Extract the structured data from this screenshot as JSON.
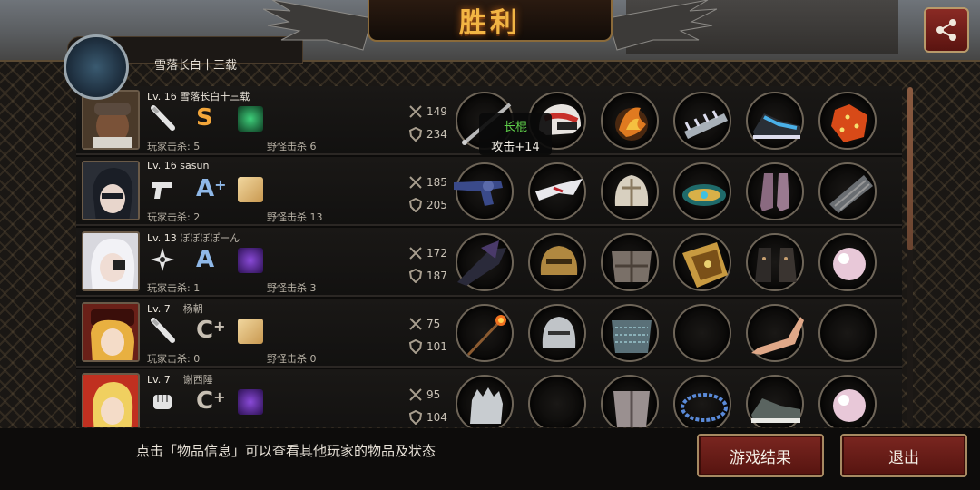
{
  "header": {
    "title": "胜利",
    "share_icon": "share-icon"
  },
  "behind_panel": {
    "player_name": "雪落长白十三载"
  },
  "tooltip": {
    "item_name": "长棍",
    "item_stat": "攻击+14"
  },
  "players": [
    {
      "level_label": "Lv. 16",
      "name": "雪落长白十三载",
      "weapon_icon": "bat-icon",
      "grade": "S",
      "grade_plus": "",
      "player_kills": "玩家击杀: 5",
      "monster_kills": "野怪击杀 6",
      "atk": "149",
      "def": "234",
      "equipment": [
        "staff",
        "racing-helmet",
        "fire-charm",
        "spiked-bracer",
        "blue-sneakers",
        "red-dice"
      ]
    },
    {
      "level_label": "Lv. 16",
      "name": "sasun",
      "weapon_icon": "pistol-icon",
      "grade": "A",
      "grade_plus": "+",
      "player_kills": "玩家击杀: 2",
      "monster_kills": "野怪击杀 13",
      "atk": "185",
      "def": "205",
      "equipment": [
        "revolver",
        "white-mask",
        "ornate-helmet",
        "gold-bracelet",
        "purple-boots",
        "steel-plate"
      ]
    },
    {
      "level_label": "Lv. 13",
      "name": "ぼぼぼぽーん",
      "weapon_icon": "shuriken-icon",
      "grade": "A",
      "grade_plus": "",
      "player_kills": "玩家击杀: 1",
      "monster_kills": "野怪击杀 3",
      "atk": "172",
      "def": "187",
      "equipment": [
        "dark-axe",
        "golden-helmet",
        "steel-armor",
        "golden-shield",
        "studded-boots",
        "pink-pearl"
      ]
    },
    {
      "level_label": "Lv. 7",
      "name": "杨朝",
      "weapon_icon": "bat-icon",
      "grade": "C",
      "grade_plus": "+",
      "player_kills": "玩家击杀: 0",
      "monster_kills": "野怪击杀 0",
      "atk": "75",
      "def": "101",
      "equipment": [
        "fire-rod",
        "knight-helmet",
        "chain-mail",
        "empty",
        "prosthetic-leg",
        "empty"
      ]
    },
    {
      "level_label": "Lv. 7",
      "name": "谢西陲",
      "weapon_icon": "fist-icon",
      "grade": "C",
      "grade_plus": "+",
      "player_kills": "",
      "monster_kills": "",
      "atk": "95",
      "def": "104",
      "equipment": [
        "gauntlet",
        "empty",
        "plate-armor",
        "bead-necklace",
        "gray-sneakers",
        "pink-pearl"
      ]
    }
  ],
  "footer": {
    "hint": "点击「物品信息」可以查看其他玩家的物品及状态",
    "results_button": "游戏结果",
    "exit_button": "退出"
  },
  "colors": {
    "accent_gold": "#f2b544",
    "button_red": "#7a2620",
    "tooltip_green": "#5fcf4a"
  }
}
